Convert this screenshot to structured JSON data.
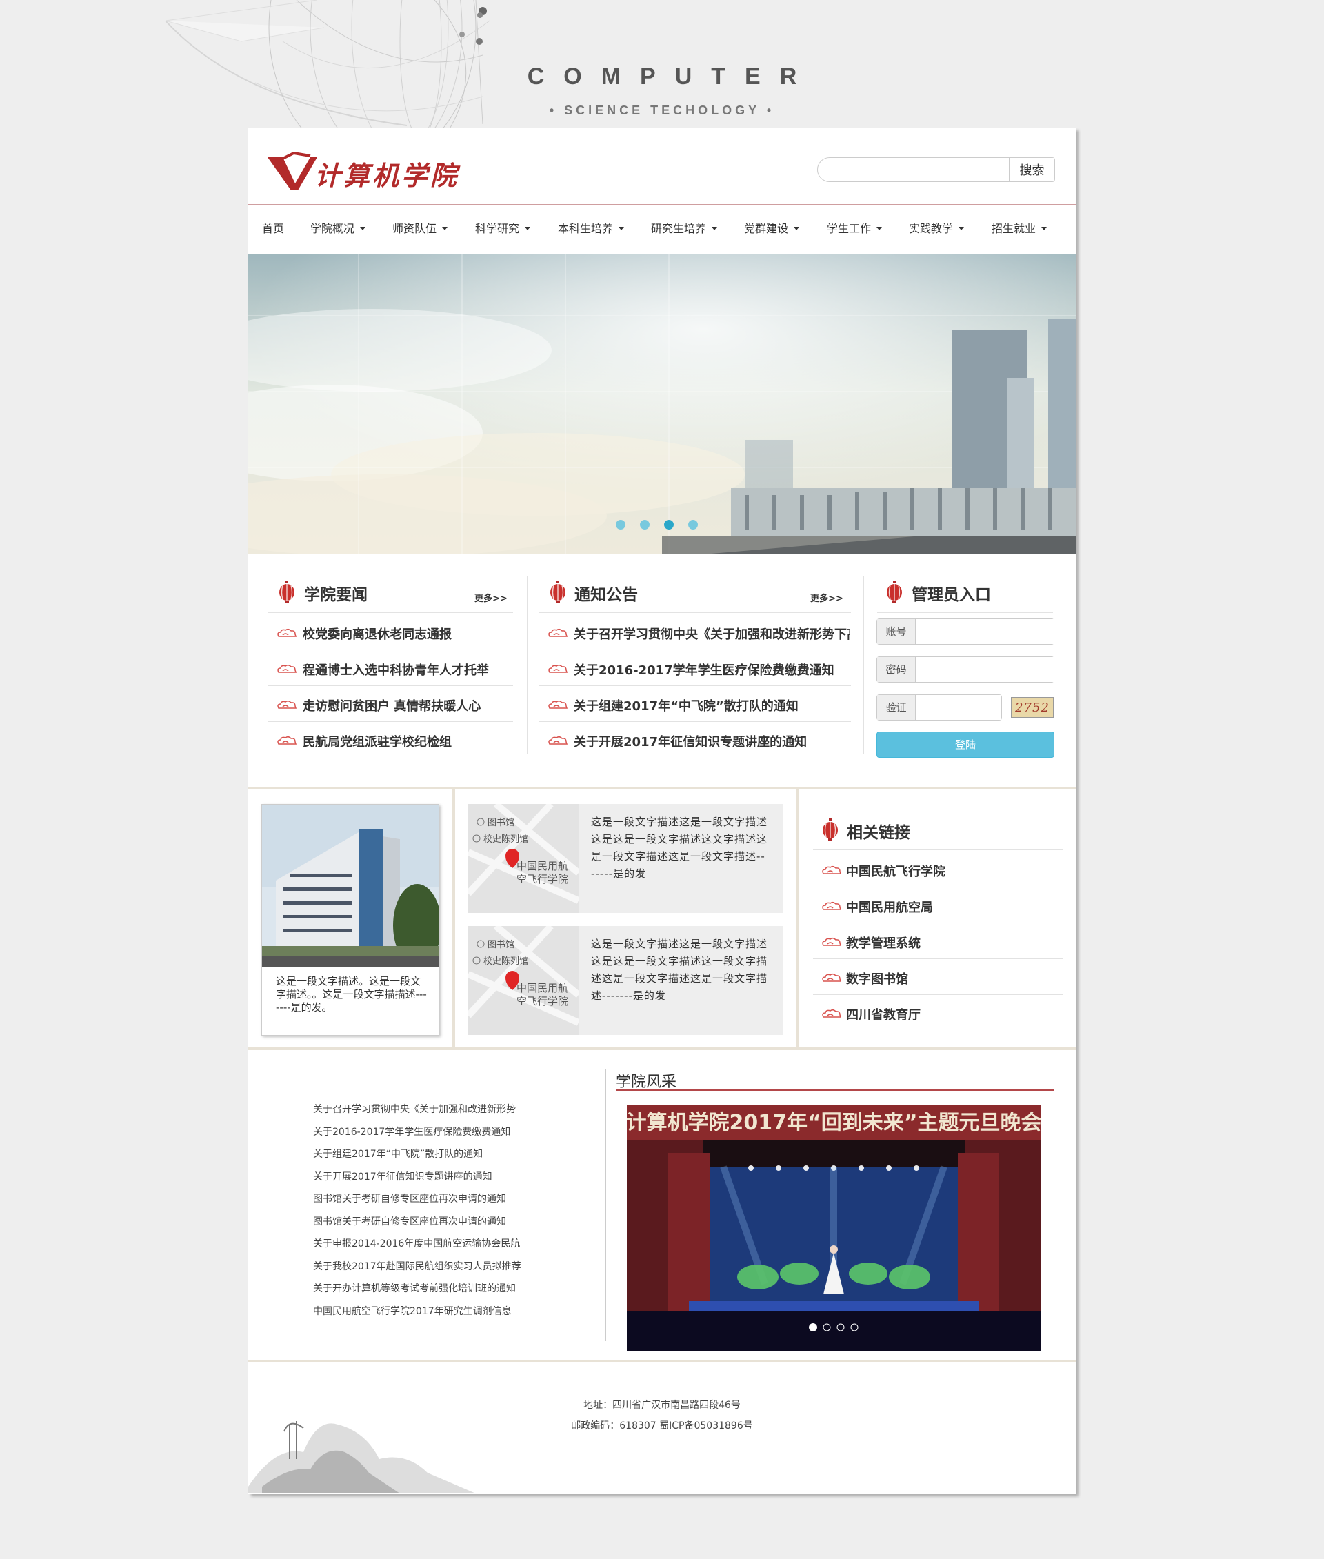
{
  "brand": {
    "word": "COMPUTER",
    "sub": "• SCIENCE TECHOLOGY •"
  },
  "header": {
    "logo_text": "计算机学院",
    "search_button": "搜索",
    "search_value": ""
  },
  "nav": [
    {
      "label": "首页",
      "dropdown": false
    },
    {
      "label": "学院概况",
      "dropdown": true
    },
    {
      "label": "师资队伍",
      "dropdown": true
    },
    {
      "label": "科学研究",
      "dropdown": true
    },
    {
      "label": "本科生培养",
      "dropdown": true
    },
    {
      "label": "研究生培养",
      "dropdown": true
    },
    {
      "label": "党群建设",
      "dropdown": true
    },
    {
      "label": "学生工作",
      "dropdown": true
    },
    {
      "label": "实践教学",
      "dropdown": true
    },
    {
      "label": "招生就业",
      "dropdown": true
    }
  ],
  "banner": {
    "slide_count": 4,
    "active_slide": 3
  },
  "news": {
    "title": "学院要闻",
    "more": "更多>>",
    "items": [
      "校党委向离退休老同志通报",
      "程通博士入选中科协青年人才托举",
      "走访慰问贫困户 真情帮扶暖人心",
      "民航局党组派驻学校纪检组"
    ]
  },
  "notice": {
    "title": "通知公告",
    "more": "更多>>",
    "items": [
      "关于召开学习贯彻中央《关于加强和改进新形势下高",
      "关于2016-2017学年学生医疗保险费缴费通知",
      "关于组建2017年“中飞院”散打队的通知",
      "关于开展2017年征信知识专题讲座的通知"
    ]
  },
  "login": {
    "title": "管理员入口",
    "account_label": "账号",
    "password_label": "密码",
    "verify_label": "验证",
    "captcha": "2752",
    "button": "登陆"
  },
  "building_card": {
    "text": "这是一段文字描述。这是一段文字描述。。这是一段文字描描述-------是的发。"
  },
  "map_cards": [
    {
      "map_labels": [
        "图书馆",
        "校史陈列馆",
        "中国民用航",
        "空飞行学院"
      ],
      "text": "这是一段文字描述这是一段文字描述这是这是一段文字描述这文字描述这是一段文字描述这是一段文字描述-------是的发"
    },
    {
      "map_labels": [
        "图书馆",
        "校史陈列馆",
        "中国民用航",
        "空飞行学院"
      ],
      "text": "这是一段文字描述这是一段文字描述这是这是一段文字描述这一段文字描述这是一段文字描述这是一段文字描述-------是的发"
    }
  ],
  "links": {
    "title": "相关链接",
    "items": [
      "中国民航飞行学院",
      "中国民用航空局",
      "教学管理系统",
      "数字图书馆",
      "四川省教育厅"
    ]
  },
  "list": [
    "关于召开学习贯彻中央《关于加强和改进新形势",
    "关于2016-2017学年学生医疗保险费缴费通知",
    "关于组建2017年“中飞院”散打队的通知",
    "关于开展2017年征信知识专题讲座的通知",
    "图书馆关于考研自修专区座位再次申请的通知",
    "图书馆关于考研自修专区座位再次申请的通知",
    "关于申报2014-2016年度中国航空运输协会民航",
    "关于我校2017年赴国际民航组织实习人员拟推荐",
    "关于开办计算机等级考试考前强化培训班的通知",
    "中国民用航空飞行学院2017年研究生调剂信息"
  ],
  "fengcai": {
    "title": "学院风采",
    "photo_caption": "计算机学院2017年“回到未来”主题元旦晚会",
    "slide_count": 4,
    "active_slide": 1
  },
  "footer": {
    "address": "地址：四川省广汉市南昌路四段46号",
    "postcode": "邮政编码：618307 蜀ICP备05031896号"
  },
  "colors": {
    "accent": "#b22a2a",
    "login_button": "#5bc0de",
    "band": "#e8e2d6"
  }
}
